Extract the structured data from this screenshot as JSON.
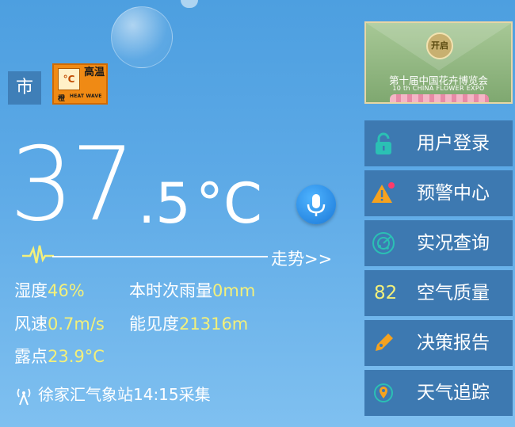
{
  "location": {
    "city_label": "市"
  },
  "warning": {
    "box_label": "°C",
    "title_zh": "高温",
    "title_en": "HEAT WAVE",
    "level": "橙"
  },
  "temperature": {
    "integer": "37",
    "decimal": ".5",
    "unit": "°C"
  },
  "trend": {
    "label": "走势>>"
  },
  "observations": {
    "humidity_label": "湿度",
    "humidity_value": "46%",
    "rain_label": "本时次雨量",
    "rain_value": "0mm",
    "wind_label": "风速",
    "wind_value": "0.7m/s",
    "visibility_label": "能见度",
    "visibility_value": "21316m",
    "dew_label": "露点",
    "dew_value": "23.9°C"
  },
  "station": {
    "text": "徐家汇气象站14:15采集"
  },
  "expo": {
    "seal": "开启",
    "title_zh": "第十届中国花卉博览会",
    "title_en": "10 th CHINA FLOWER EXPO"
  },
  "menu": {
    "login": "用户登录",
    "alerts": "预警中心",
    "live": "实况查询",
    "aqi_value": "82",
    "aqi": "空气质量",
    "report": "决策报告",
    "tracking": "天气追踪"
  },
  "colors": {
    "accent_value": "#f3f07a",
    "menu_bg": "#3d79b1",
    "icon_teal": "#2bc0b4"
  }
}
